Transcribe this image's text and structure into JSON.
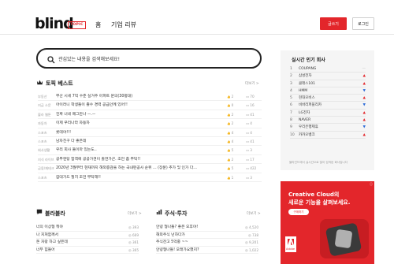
{
  "header": {
    "logo": "blind",
    "logo_badge": "TOPIC",
    "nav_home": "홈",
    "nav_review": "기업 리뷰",
    "write_button": "글쓰기",
    "login_button": "로그인"
  },
  "search": {
    "placeholder": "관심있는 내용을 검색해보세요!"
  },
  "topic_best": {
    "title": "토픽 베스트",
    "more": "더보기 >",
    "rows": [
      {
        "topic": "부동산",
        "title": "부산 시세 7억 수준 실거주 아파트 문의(30평대)",
        "likes": "2",
        "comments": "70"
      },
      {
        "topic": "지금 소문",
        "title": "아이러니 학생들이 졸수 경력 공급안께 있어!!",
        "likes": "0",
        "comments": "16"
      },
      {
        "topic": "블라 웹툰",
        "title": "진짜 너네 메그만나 ㅡ.ㅡ",
        "likes": "2",
        "comments": "41"
      },
      {
        "topic": "자동차",
        "title": "이제 우리나라 자동차",
        "likes": "2",
        "comments": "4"
      },
      {
        "topic": "스포츠",
        "title": "롯데야!!!",
        "likes": "4",
        "comments": "4"
      },
      {
        "topic": "스포츠",
        "title": "남자친구 다 좋은데",
        "likes": "4",
        "comments": "41"
      },
      {
        "topic": "회사생활",
        "title": "우리 회사 둘이마 있는도..",
        "likes": "5",
        "comments": "3"
      },
      {
        "topic": "지식 라이브",
        "title": "공부엔탕 합격에 공공가견이 출연가곤. 조언 좀 부탁!!",
        "likes": "2",
        "comments": "17"
      },
      {
        "topic": "금융/재테크",
        "title": "2020년 3월부터 현재까지 해외증감을 하는 국내펀공사 순위 ... (장문) 추가 및 인가 다...",
        "likes": "5",
        "comments": "422"
      },
      {
        "topic": "스포츠",
        "title": "캄대가드 질치 조언 부탁해!!",
        "likes": "1",
        "comments": "3"
      }
    ]
  },
  "section_left": {
    "title": "블라블라",
    "more": "더보기 >",
    "rows": [
      {
        "title": "너의 이상형 뭐야",
        "value": "393"
      },
      {
        "title": "나 지쳐함께서",
        "value": "669"
      },
      {
        "title": "돈 자랑 하고 싶은데",
        "value": "361"
      },
      {
        "title": "너무 힘들어",
        "value": "365"
      }
    ]
  },
  "section_right": {
    "title": "주식·투자",
    "more": "더보기 >",
    "rows": [
      {
        "title": "안녕 형나들? 좋은 오후야!",
        "value": "4,520"
      },
      {
        "title": "해외주식 넌하다가",
        "value": "738"
      },
      {
        "title": "주식잔고 5억중 ~~",
        "value": "9,201"
      },
      {
        "title": "안녕형나들! 오래가요했지?",
        "value": "1,022"
      }
    ]
  },
  "ranking": {
    "title": "실시간 인기 회사",
    "items": [
      {
        "rank": "1",
        "company": "COUPANG",
        "trend": "—",
        "trend_color": "#bbbbbb"
      },
      {
        "rank": "2",
        "company": "삼성전자",
        "trend": "▲",
        "trend_color": "#e3262b"
      },
      {
        "rank": "3",
        "company": "클래스101",
        "trend": "▲",
        "trend_color": "#e3262b"
      },
      {
        "rank": "4",
        "company": "HMM",
        "trend": "▼",
        "trend_color": "#2b6ad8"
      },
      {
        "rank": "5",
        "company": "현대모비스",
        "trend": "▲",
        "trend_color": "#e3262b"
      },
      {
        "rank": "6",
        "company": "비바리퍼블리카",
        "trend": "▼",
        "trend_color": "#2b6ad8"
      },
      {
        "rank": "7",
        "company": "LG전자",
        "trend": "▲",
        "trend_color": "#e3262b"
      },
      {
        "rank": "8",
        "company": "NAVER",
        "trend": "▲",
        "trend_color": "#e3262b"
      },
      {
        "rank": "9",
        "company": "우리은행제휴",
        "trend": "▼",
        "trend_color": "#2b6ad8"
      },
      {
        "rank": "10",
        "company": "카카오뱅크",
        "trend": "▲",
        "trend_color": "#e3262b"
      }
    ],
    "note": "블라인드에서 실시간으로 많이 검색된 회사입니다"
  },
  "ad": {
    "line1": "Creative Cloud의",
    "line2": "새로운 기능을 살펴보세요.",
    "button": "구매하기",
    "logo_text": "Adobe"
  }
}
